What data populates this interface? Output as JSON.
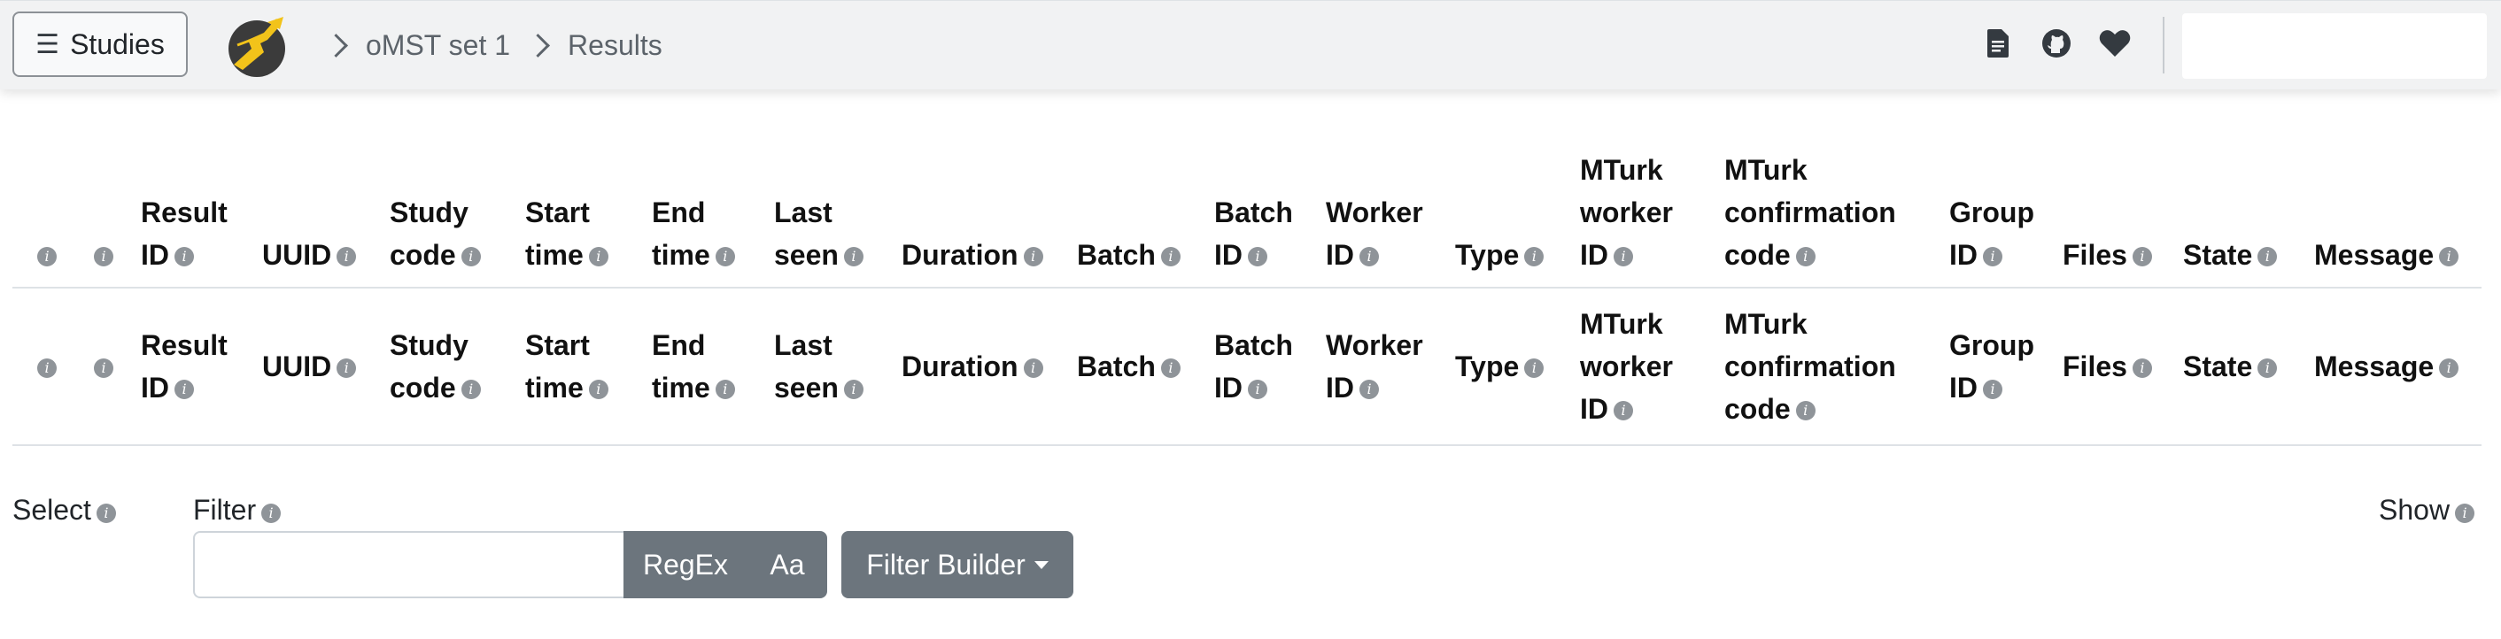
{
  "nav": {
    "studies_label": "Studies",
    "breadcrumb": {
      "study": "oMST set 1",
      "page": "Results"
    },
    "icons": [
      "document-icon",
      "github-icon",
      "heart-icon"
    ]
  },
  "table": {
    "headers": [
      {
        "key": "h-check",
        "text": ""
      },
      {
        "key": "h-info",
        "text": ""
      },
      {
        "key": "result-id",
        "text": "Result ID"
      },
      {
        "key": "uuid",
        "text": "UUID"
      },
      {
        "key": "study-code",
        "text": "Study code"
      },
      {
        "key": "start-time",
        "text": "Start time"
      },
      {
        "key": "end-time",
        "text": "End time"
      },
      {
        "key": "last-seen",
        "text": "Last seen"
      },
      {
        "key": "duration",
        "text": "Duration"
      },
      {
        "key": "batch",
        "text": "Batch"
      },
      {
        "key": "batch-id",
        "text": "Batch ID"
      },
      {
        "key": "worker-id",
        "text": "Worker ID"
      },
      {
        "key": "type",
        "text": "Type"
      },
      {
        "key": "mturk-worker-id",
        "text": "MTurk worker ID"
      },
      {
        "key": "mturk-confirmation-code",
        "text": "MTurk confirmation code"
      },
      {
        "key": "group-id",
        "text": "Group ID"
      },
      {
        "key": "files",
        "text": "Files"
      },
      {
        "key": "state",
        "text": "State"
      },
      {
        "key": "message",
        "text": "Message"
      }
    ],
    "info_glyph": "i"
  },
  "controls": {
    "select_label": "Select",
    "filter_label": "Filter",
    "show_label": "Show",
    "filter_value": "",
    "regex_label": "RegEx",
    "case_label": "Aa",
    "filter_builder_label": "Filter Builder"
  },
  "colors": {
    "navbar_bg": "#f1f2f3",
    "button_grey": "#6c757d",
    "info_icon": "#8f9499"
  }
}
